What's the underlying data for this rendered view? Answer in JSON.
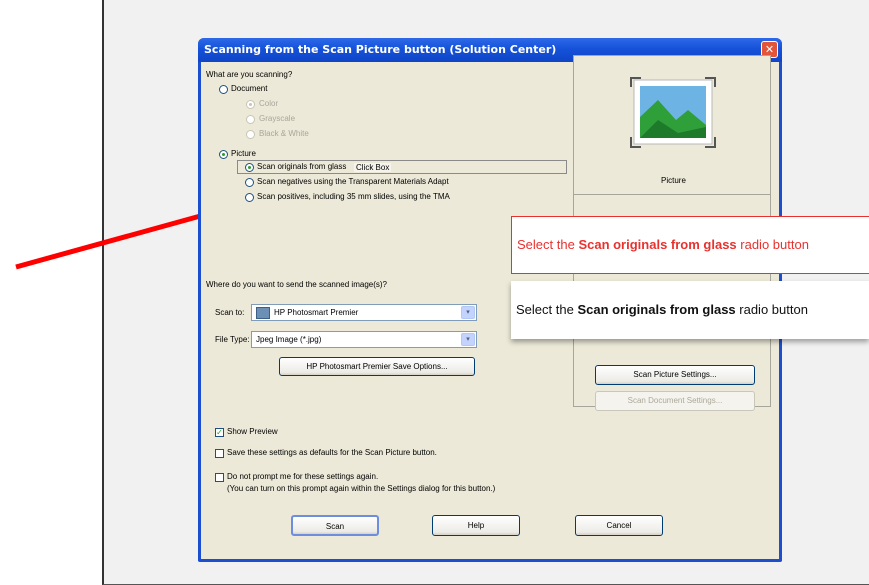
{
  "dialog": {
    "title": "Scanning from the Scan Picture button (Solution Center)",
    "close_label": "✕",
    "question": "What are you scanning?",
    "document_label": "Document",
    "color_label": "Color",
    "grayscale_label": "Grayscale",
    "bw_label": "Black & White",
    "picture_label": "Picture",
    "scan_originals_label": "Scan originals from glass",
    "click_box_label": "Click Box",
    "scan_negatives_label": "Scan negatives using the Transparent Materials Adapt",
    "scan_positives_label": "Scan positives, including 35 mm slides, using the TMA",
    "preview_caption": "Picture",
    "send_question": "Where do you want to send the scanned image(s)?",
    "scan_to_label": "Scan to:",
    "scan_to_value": "HP Photosmart Premier",
    "file_type_label": "File Type:",
    "file_type_value": "Jpeg Image (*.jpg)",
    "save_options_button": "HP Photosmart Premier Save Options...",
    "scan_picture_settings_button": "Scan Picture Settings...",
    "scan_document_settings_button": "Scan Document Settings...",
    "show_preview_label": "Show Preview",
    "save_defaults_label": "Save these settings as defaults for the Scan Picture button.",
    "no_prompt_label": "Do not prompt me for these settings again.",
    "no_prompt_note": "(You can turn on this prompt again within the Settings dialog for this button.)",
    "scan_button": "Scan",
    "help_button": "Help",
    "cancel_button": "Cancel",
    "dropdown_glyph": "▾",
    "checkmark": "✓"
  },
  "callouts": {
    "red_prefix": "Select the ",
    "red_bold": "Scan originals from glass",
    "red_suffix": " radio button",
    "black_prefix": "Select the ",
    "black_bold": "Scan originals from glass",
    "black_suffix": " radio button"
  },
  "colors": {
    "arrow": "#ff0000",
    "callout_red": "#e8322f",
    "titlebar": "#1552d9"
  }
}
